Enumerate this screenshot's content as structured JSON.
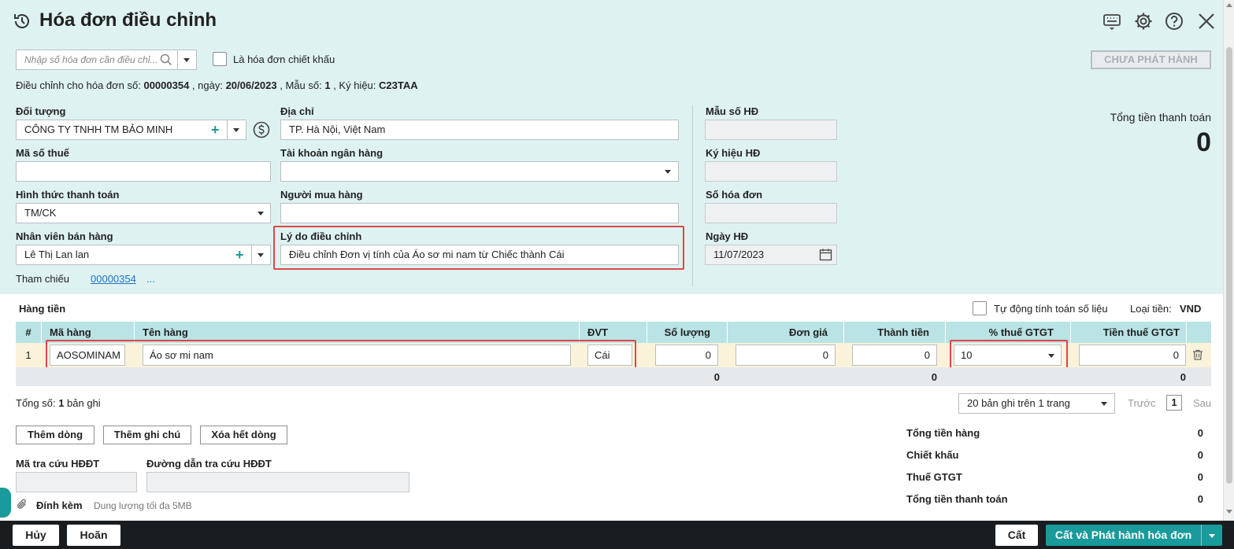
{
  "header": {
    "title": "Hóa đơn điều chỉnh",
    "icons": [
      "history-icon",
      "keyboard-icon",
      "gear-icon",
      "help-icon",
      "close-icon"
    ]
  },
  "search": {
    "placeholder": "Nhập số hóa đơn cần điều chỉ...",
    "discount_checkbox_label": "Là hóa đơn chiết khấu",
    "discount_checked": false,
    "status_button": "CHƯA PHÁT HÀNH"
  },
  "adjust_info": {
    "prefix": "Điều chỉnh cho hóa đơn số: ",
    "invoice_no": "00000354",
    "date_prefix": " , ngày: ",
    "date": "20/06/2023",
    "form_prefix": " , Mẫu số: ",
    "form_no": "1",
    "symbol_prefix": " , Ký hiệu: ",
    "symbol": "C23TAA"
  },
  "form": {
    "doi_tuong_label": "Đối tượng",
    "doi_tuong_value": "CÔNG TY TNHH TM BẢO MINH",
    "dia_chi_label": "Địa chỉ",
    "dia_chi_value": "TP. Hà Nội, Việt Nam",
    "mau_so_label": "Mẫu số HĐ",
    "ma_so_thue_label": "Mã số thuế",
    "tai_khoan_label": "Tài khoản ngân hàng",
    "ky_hieu_label": "Ký hiệu HĐ",
    "hinh_thuc_label": "Hình thức thanh toán",
    "hinh_thuc_value": "TM/CK",
    "nguoi_mua_label": "Người mua hàng",
    "so_hoa_don_label": "Số hóa đơn",
    "nhan_vien_label": "Nhân viên bán hàng",
    "nhan_vien_value": "Lê Thị Lan lan",
    "ly_do_label": "Lý do điều chỉnh",
    "ly_do_value": "Điều chỉnh Đơn vị tính của Áo sơ mi nam từ Chiếc thành Cái",
    "ngay_hd_label": "Ngày HĐ",
    "ngay_hd_value": "11/07/2023",
    "tham_chieu_label": "Tham chiếu",
    "tham_chieu_value": "00000354",
    "tham_chieu_more": "...",
    "tong_tien_label": "Tổng tiền thanh toán",
    "tong_tien_value": "0"
  },
  "grid_section": {
    "title": "Hàng tiền",
    "auto_calc_label": "Tự động tính toán số liệu",
    "currency_label": "Loại tiền:",
    "currency_value": "VND",
    "columns": [
      "#",
      "Mã hàng",
      "Tên hàng",
      "ĐVT",
      "Số lượng",
      "Đơn giá",
      "Thành tiền",
      "% thuế GTGT",
      "Tiền thuế GTGT"
    ],
    "rows": [
      {
        "no": "1",
        "ma_hang": "AOSOMINAM",
        "ten_hang": "Áo sơ mi nam",
        "dvt": "Cái",
        "so_luong": "0",
        "don_gia": "0",
        "thanh_tien": "0",
        "thue_pct": "10",
        "tien_thue": "0"
      }
    ],
    "totals": {
      "so_luong": "0",
      "thanh_tien": "0",
      "tien_thue": "0"
    }
  },
  "pagination": {
    "total_prefix": "Tổng số: ",
    "total_count": "1",
    "total_suffix": " bản ghi",
    "page_size": "20 bản ghi trên 1 trang",
    "prev": "Trước",
    "page": "1",
    "next": "Sau"
  },
  "actions": {
    "add_row": "Thêm dòng",
    "add_note": "Thêm ghi chú",
    "delete_all": "Xóa hết dòng"
  },
  "lookup": {
    "code_label": "Mã tra cứu HĐĐT",
    "link_label": "Đường dẫn tra cứu HĐĐT",
    "attach_label": "Đính kèm",
    "attach_hint": "Dung lượng tối đa 5MB"
  },
  "summary": {
    "items": [
      {
        "label": "Tổng tiền hàng",
        "value": "0"
      },
      {
        "label": "Chiết khấu",
        "value": "0"
      },
      {
        "label": "Thuế GTGT",
        "value": "0"
      },
      {
        "label": "Tổng tiền thanh toán",
        "value": "0"
      }
    ]
  },
  "footer": {
    "cancel": "Hủy",
    "postpone": "Hoãn",
    "save": "Cất",
    "save_publish": "Cất và Phát hành hóa đơn"
  },
  "colors": {
    "top_bg": "#dff2f2",
    "grid_header": "#b9e3e5",
    "accent": "#1a9a9a",
    "highlight": "#e0454a",
    "footer_bg": "#1a1d1f"
  }
}
